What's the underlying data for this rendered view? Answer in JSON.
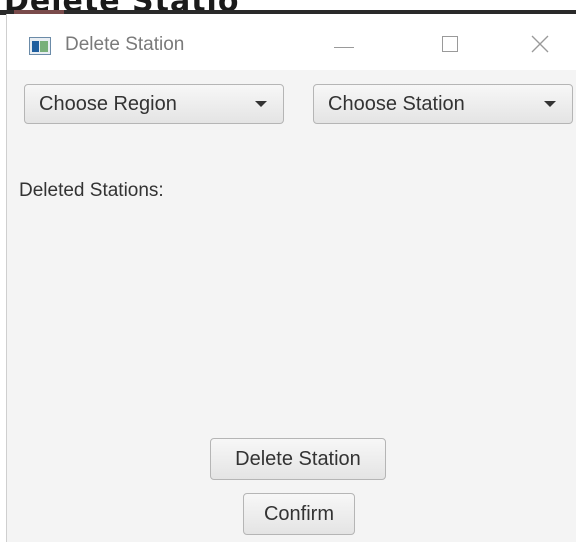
{
  "background_window": {
    "partial_title": "Delete Statio"
  },
  "window": {
    "title": "Delete Station",
    "controls": {
      "minimize": "minimize",
      "maximize": "maximize",
      "close": "close"
    }
  },
  "filters": {
    "region": {
      "label": "Choose Region"
    },
    "station": {
      "label": "Choose Station"
    }
  },
  "main": {
    "deleted_label": "Deleted Stations:"
  },
  "actions": {
    "delete_label": "Delete Station",
    "confirm_label": "Confirm"
  },
  "colors": {
    "window_bg": "#f4f4f4",
    "titlebar_bg": "#ffffff",
    "text": "#333333",
    "button_border": "#b5b5b5"
  }
}
